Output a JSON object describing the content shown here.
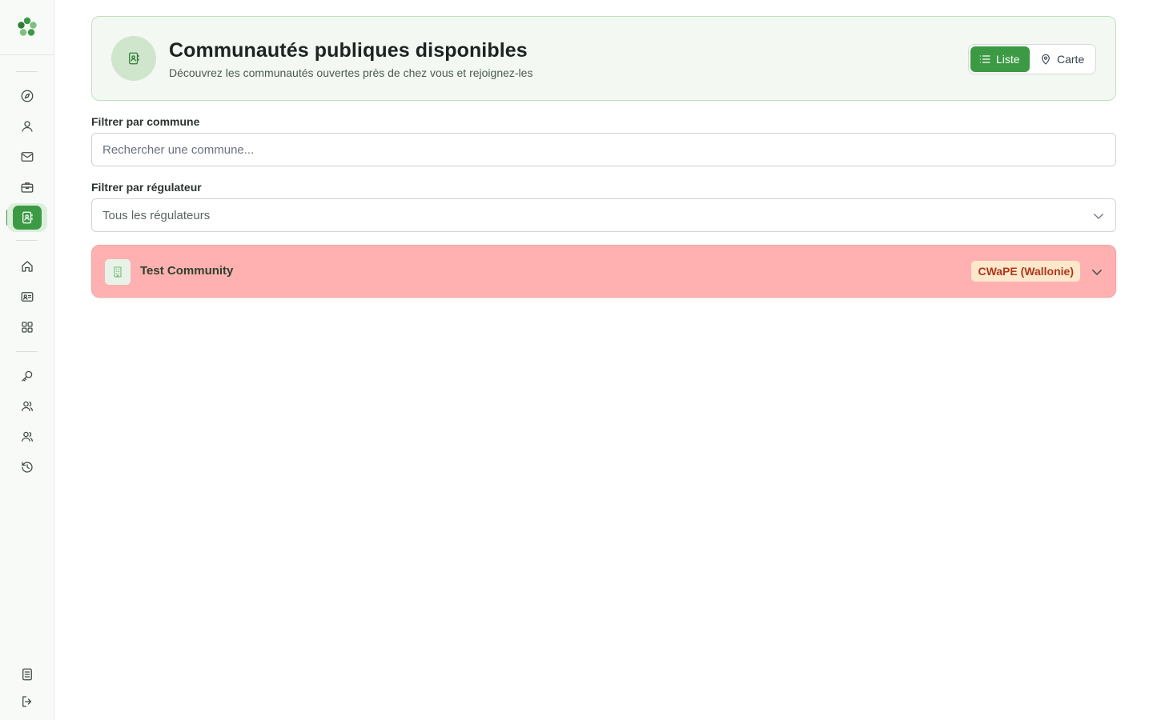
{
  "header": {
    "title": "Communautés publiques disponibles",
    "subtitle": "Découvrez les communautés ouvertes près de chez vous et rejoignez-les",
    "view_list_label": "Liste",
    "view_map_label": "Carte"
  },
  "filters": {
    "commune_label": "Filtrer par commune",
    "commune_placeholder": "Rechercher une commune...",
    "regulator_label": "Filtrer par régulateur",
    "regulator_value": "Tous les régulateurs"
  },
  "communities": [
    {
      "name": "Test Community",
      "regulator": "CWaPE (Wallonie)"
    }
  ],
  "colors": {
    "accent": "#3c9a44",
    "community_row_bg": "#ffb1b1",
    "badge_bg": "#fde8cc",
    "badge_text": "#b0361b"
  },
  "sidebar": {
    "active_item": "communities-icon",
    "icons": [
      "compass-icon",
      "user-icon",
      "mail-icon",
      "briefcase-icon",
      "communities-icon",
      "home-icon",
      "id-card-icon",
      "grid-icon",
      "key-icon",
      "users-icon",
      "users-alt-icon",
      "history-icon",
      "document-icon",
      "logout-icon"
    ]
  }
}
